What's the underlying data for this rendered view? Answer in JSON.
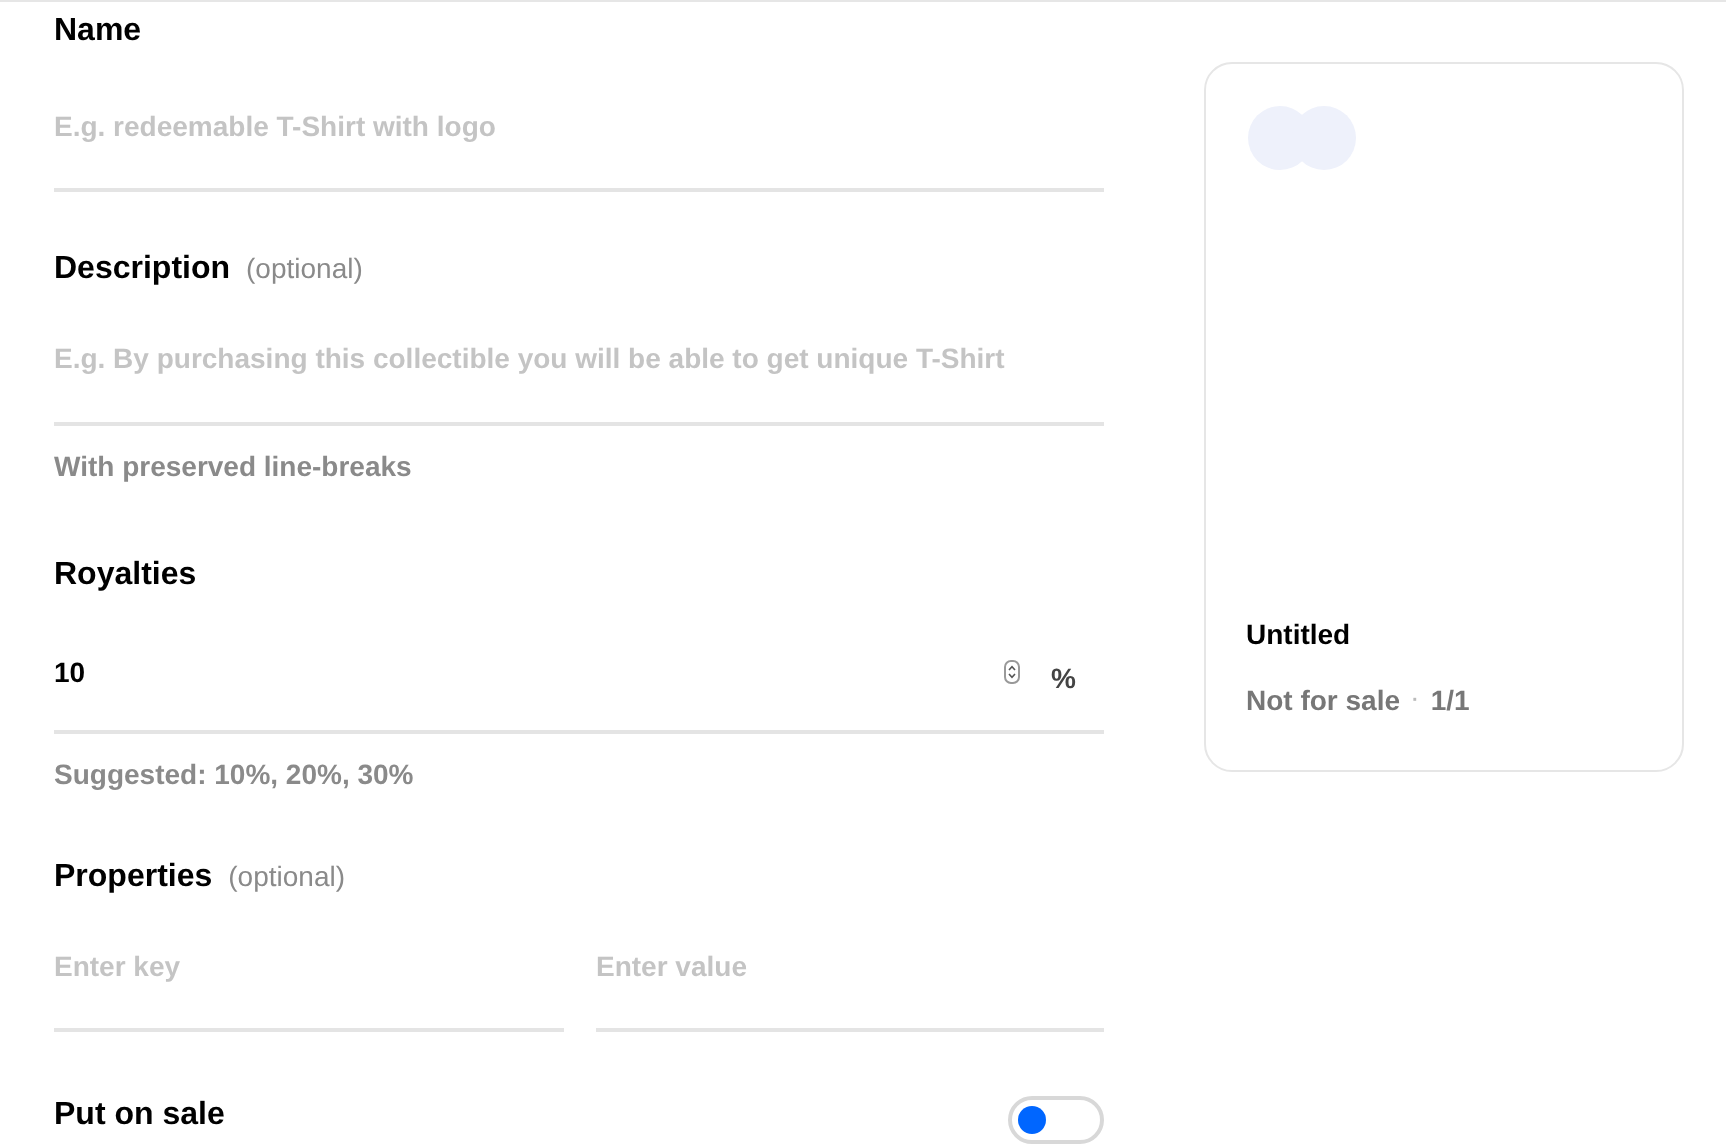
{
  "name": {
    "label": "Name",
    "placeholder": "E.g. redeemable T-Shirt with logo"
  },
  "description": {
    "label": "Description",
    "optional": "(optional)",
    "placeholder": "E.g. By purchasing this collectible you will be able to get unique T-Shirt",
    "hint": "With preserved line-breaks"
  },
  "royalties": {
    "label": "Royalties",
    "value": "10",
    "unit": "%",
    "hint": "Suggested: 10%, 20%, 30%"
  },
  "properties": {
    "label": "Properties",
    "optional": "(optional)",
    "key_placeholder": "Enter key",
    "value_placeholder": "Enter value"
  },
  "put_on_sale": {
    "label": "Put on sale",
    "on": false
  },
  "preview": {
    "title": "Untitled",
    "status": "Not for sale",
    "separator": "·",
    "edition": "1/1"
  }
}
